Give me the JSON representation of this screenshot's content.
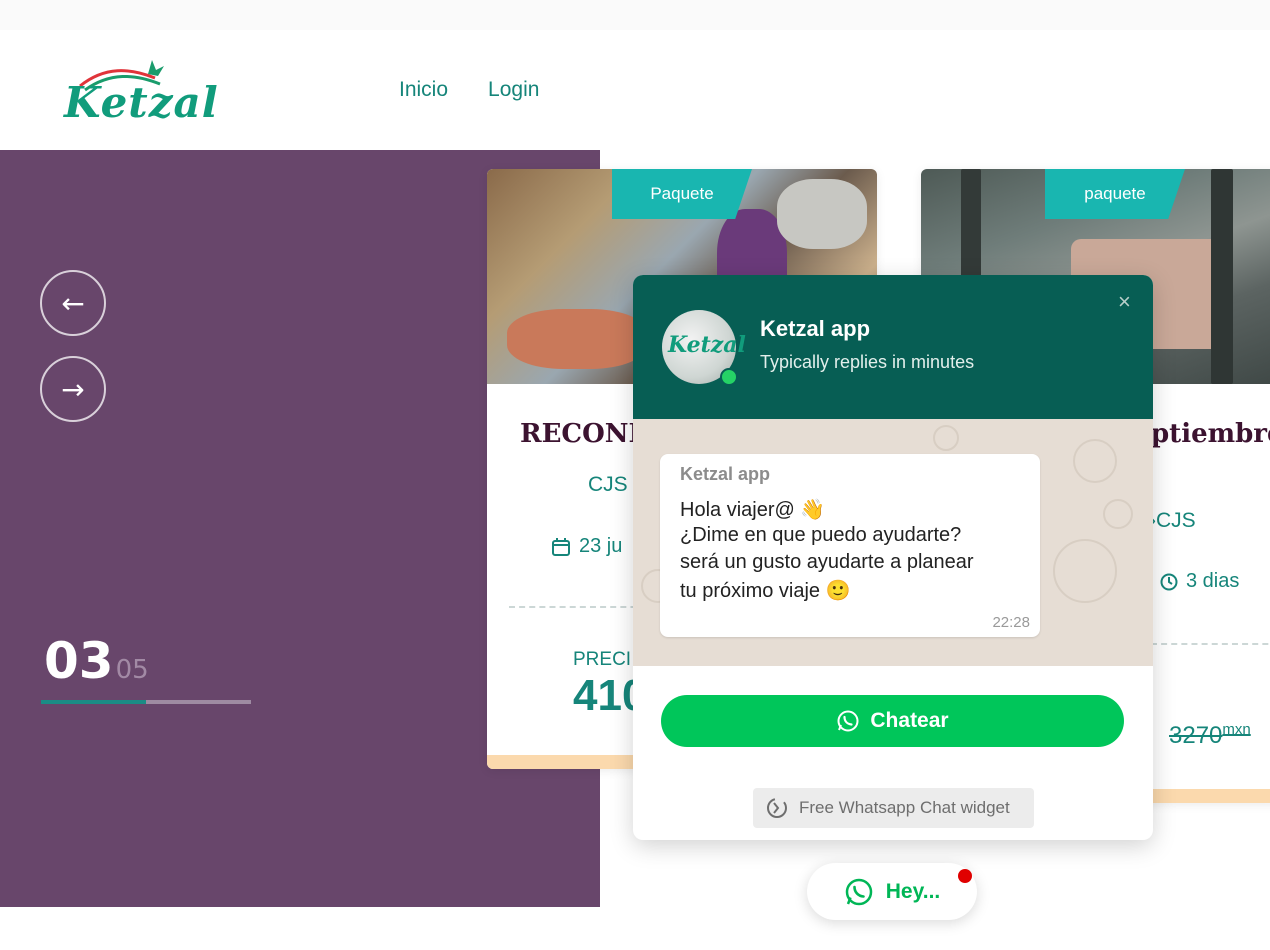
{
  "brand": {
    "logo_text": "Ketzal"
  },
  "nav": {
    "items": [
      "Inicio",
      "Login"
    ]
  },
  "slider": {
    "prev_arrow": "←",
    "next_arrow": "→",
    "current": "03",
    "total": "05",
    "progress_fraction": 0.5
  },
  "cards": [
    {
      "badge": "Paquete",
      "title": "RECONI",
      "route": "CJS",
      "date": "23 ju",
      "price_label": "PRECI",
      "price": "410"
    },
    {
      "badge": "paquete",
      "title": "ptiembre",
      "route": "›CJS",
      "duration": "3 dias",
      "old_price": "3270",
      "currency": "mxn"
    }
  ],
  "chat_widget": {
    "name": "Ketzal app",
    "status": "Typically replies in minutes",
    "avatar_text": "Ketzal",
    "close_glyph": "×",
    "message": {
      "sender": "Ketzal app",
      "lines": [
        "Hola viajer@ 👋",
        "¿Dime en que puedo ayudarte?",
        "será un gusto ayudarte a planear",
        "tu próximo viaje 🙂"
      ],
      "time": "22:28"
    },
    "button_label": "Chatear",
    "footer_label": "Free Whatsapp Chat widget"
  },
  "launcher": {
    "label": "Hey..."
  },
  "colors": {
    "teal": "#16857a",
    "purple_panel": "#68466b",
    "whatsapp_header": "#075e54",
    "whatsapp_green": "#00c65a",
    "badge_teal": "#19b6b0"
  }
}
